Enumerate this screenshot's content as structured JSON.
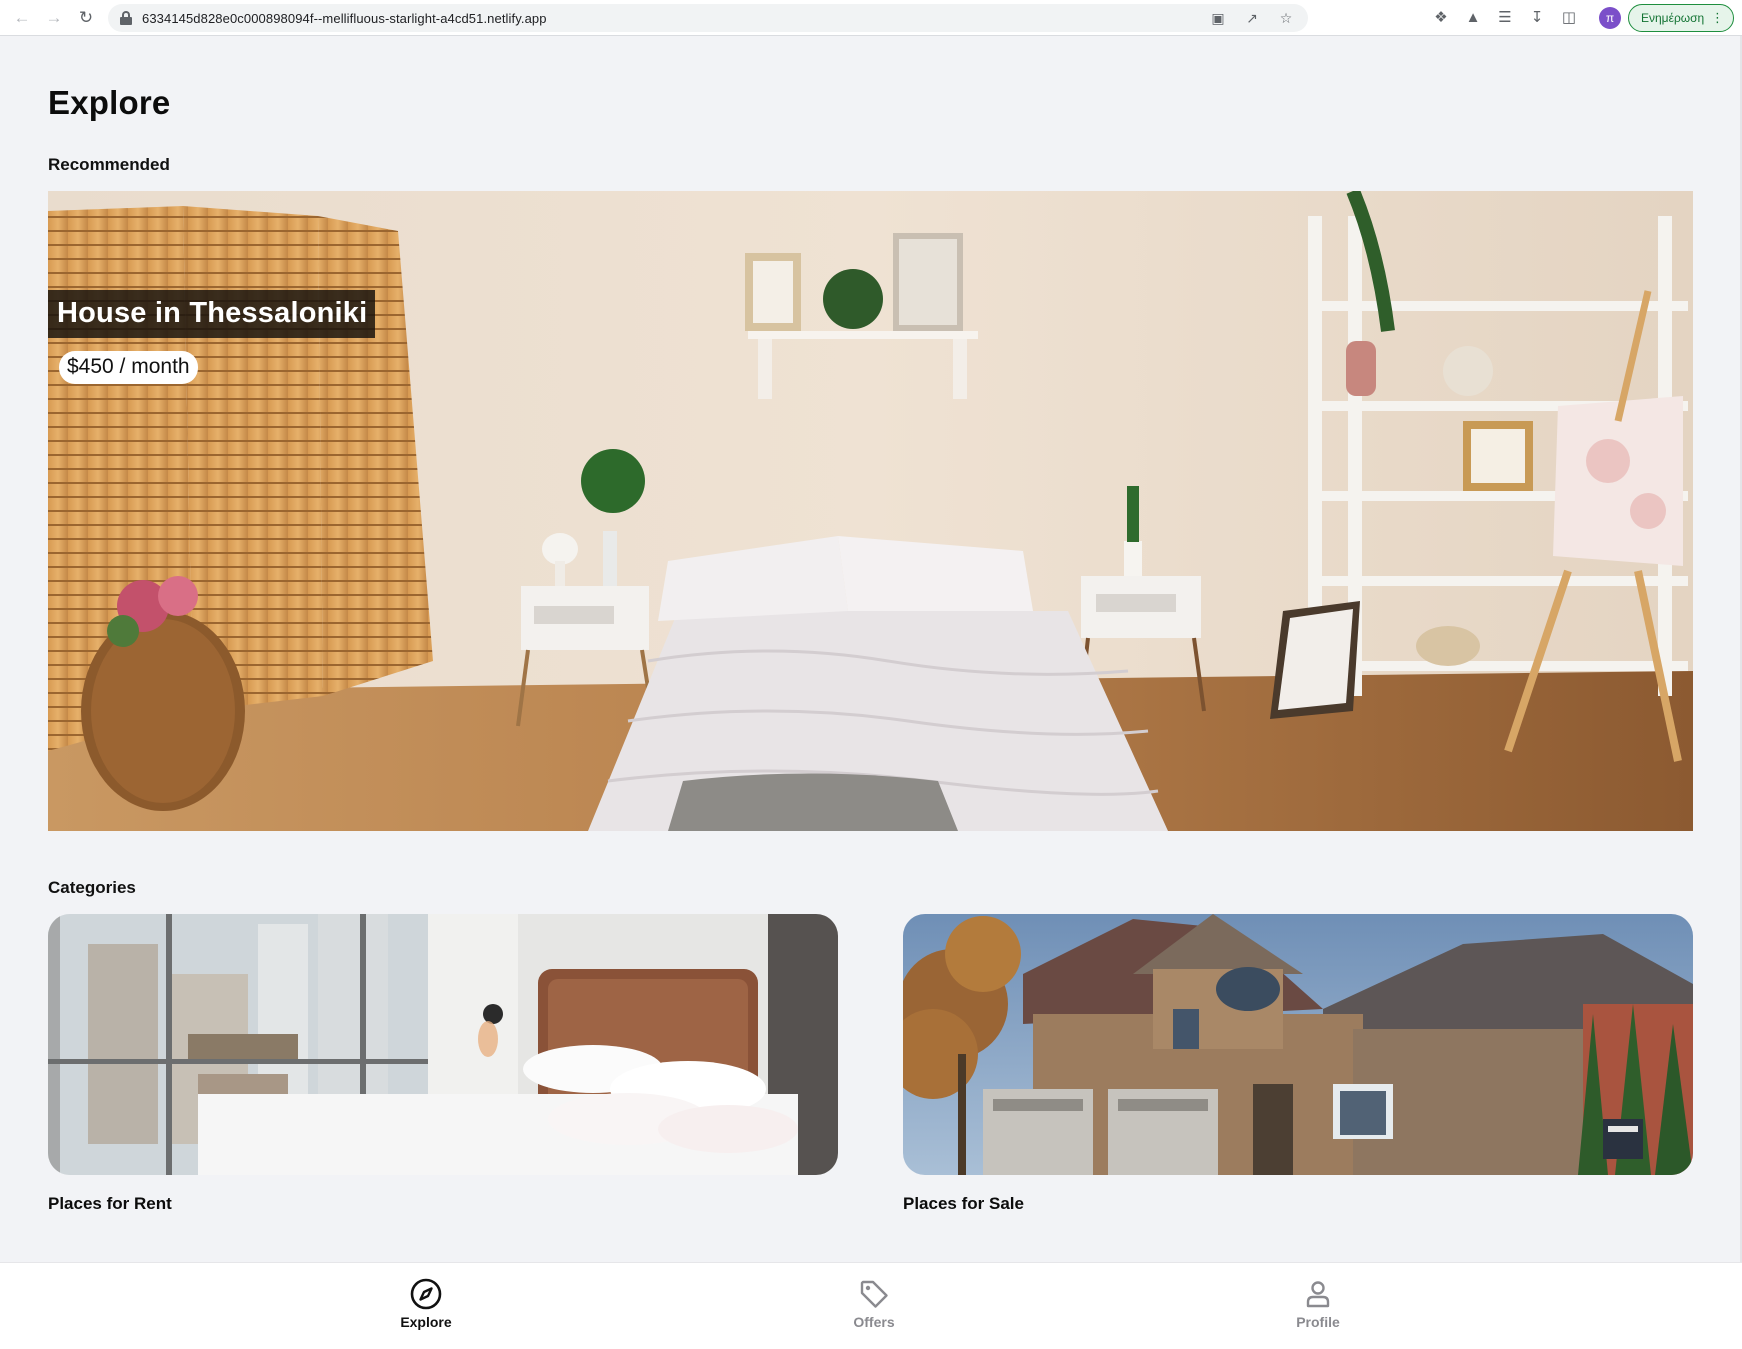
{
  "browser": {
    "url": "6334145d828e0c000898094f--mellifluous-starlight-a4cd51.netlify.app",
    "avatar_initial": "π",
    "update_label": "Ενημέρωση",
    "update_menu": "⋮"
  },
  "page": {
    "title": "Explore"
  },
  "recommended": {
    "heading": "Recommended",
    "listing": {
      "name": "House in Thessaloniki",
      "price": "$450 / month"
    }
  },
  "categories": {
    "heading": "Categories",
    "items": [
      {
        "label": "Places for Rent",
        "image": "bedroom-city-view-photo"
      },
      {
        "label": "Places for Sale",
        "image": "brick-house-photo"
      }
    ]
  },
  "bottom_nav": {
    "items": [
      {
        "label": "Explore",
        "icon": "compass-icon",
        "active": true
      },
      {
        "label": "Offers",
        "icon": "tag-icon",
        "active": false
      },
      {
        "label": "Profile",
        "icon": "person-icon",
        "active": false
      }
    ]
  },
  "colors": {
    "page_bg": "#f2f3f6",
    "active_nav": "#111111",
    "inactive_nav": "#8a8a8f",
    "update_green": "#137333"
  }
}
